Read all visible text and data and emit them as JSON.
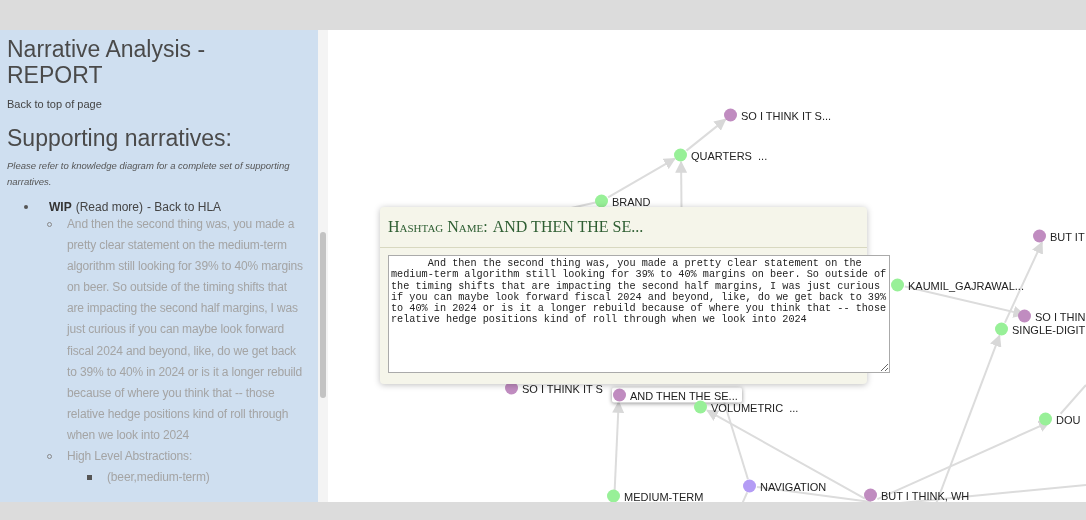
{
  "report": {
    "title": "Narrative Analysis - REPORT",
    "back_link": "Back to top of page",
    "section_title": "Supporting narratives:",
    "note": "Please refer to knowledge diagram for a complete set of supporting narratives.",
    "items": [
      {
        "label": "WIP",
        "read_more": "(Read more)",
        "back": "- Back to HLA",
        "children": [
          {
            "text": "And then the second thing was, you made a pretty clear statement on the medium-term algorithm still looking for 39% to 40% margins on beer. So outside of the timing shifts that are impacting the second half margins, I was just curious if you can maybe look forward fiscal 2024 and beyond, like, do we get back to 39% to 40% in 2024 or is it a longer rebuild because of where you think that -- those relative hedge positions kind of roll through when we look into 2024"
          },
          {
            "text": "High Level Abstractions:",
            "children": [
              {
                "text": "(beer,medium-term)"
              }
            ]
          }
        ]
      }
    ]
  },
  "graph": {
    "nodes": [
      {
        "label": "SO I THINK IT S...",
        "color": "#c08cc0",
        "selected": false
      },
      {
        "label": "QUARTERS  ...",
        "color": "#98f098",
        "selected": false
      },
      {
        "label": "BRAND",
        "color": "#98f098",
        "selected": false
      },
      {
        "label": "BUT IT",
        "color": "#c08cc0",
        "selected": false
      },
      {
        "label": "KAUMIL_GAJRAWAL...",
        "color": "#98f098",
        "selected": false
      },
      {
        "label": "SO I THIN",
        "color": "#c08cc0",
        "selected": false
      },
      {
        "label": "SINGLE-DIGIT",
        "color": "#98f098",
        "selected": false
      },
      {
        "label": "SO I THINK IT S",
        "color": "#c08cc0",
        "selected": false
      },
      {
        "label": "AND THEN THE SE...",
        "color": "#c08cc0",
        "selected": true
      },
      {
        "label": "VOLUMETRIC  ...",
        "color": "#98f098",
        "selected": false
      },
      {
        "label": "DOU",
        "color": "#98f098",
        "selected": false
      },
      {
        "label": "MEDIUM-TERM",
        "color": "#98f098",
        "selected": false
      },
      {
        "label": "NAVIGATION",
        "color": "#b49cf5",
        "selected": false
      },
      {
        "label": "BUT I THINK, WH",
        "color": "#c08cc0",
        "selected": false
      }
    ]
  },
  "popup": {
    "heading_label": "Hashtag Name:",
    "heading_value": "AND THEN THE SE...",
    "text": "And then the second thing was, you made a pretty clear statement on the medium-term algorithm still looking for 39% to 40% margins on beer. So outside of the timing shifts that are impacting the second half margins, I was just curious if you can maybe look forward fiscal 2024 and beyond, like, do we get back to 39% to 40% in 2024 or is it a longer rebuild because of where you think that -- those relative hedge positions kind of roll through when we look into 2024"
  }
}
